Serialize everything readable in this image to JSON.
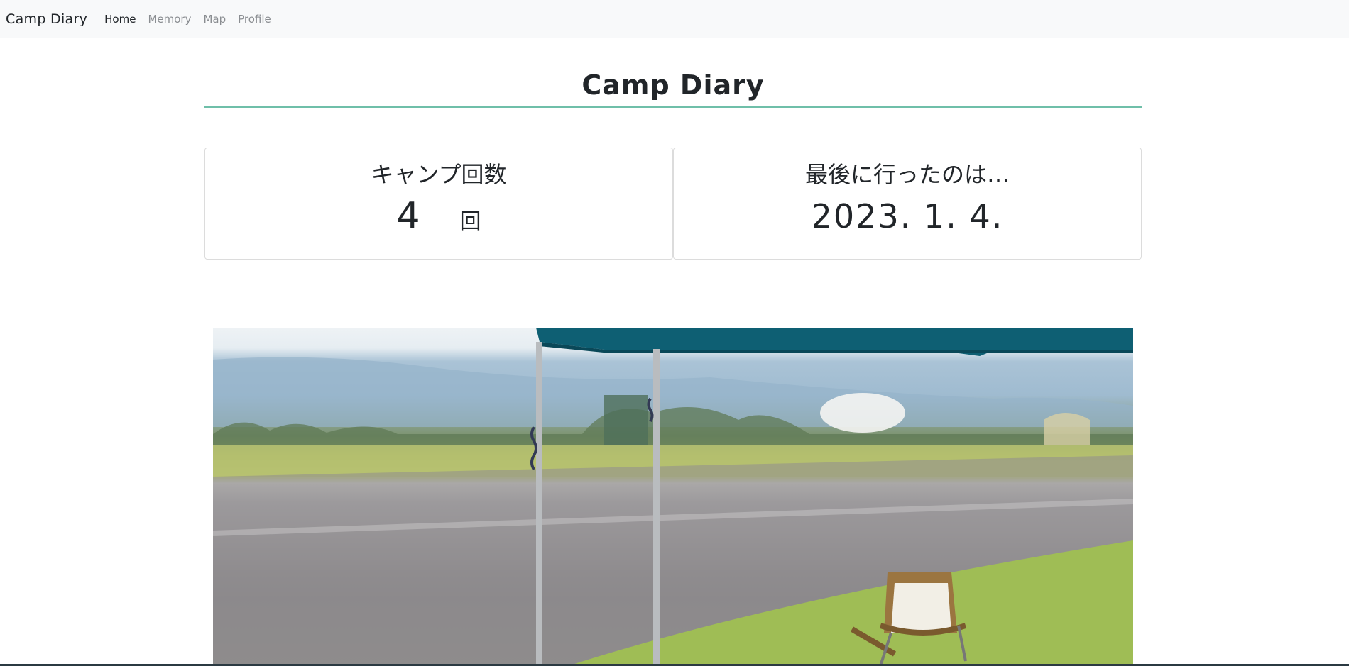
{
  "nav": {
    "brand": "Camp Diary",
    "links": [
      {
        "label": "Home",
        "active": true
      },
      {
        "label": "Memory",
        "active": false
      },
      {
        "label": "Map",
        "active": false
      },
      {
        "label": "Profile",
        "active": false
      }
    ]
  },
  "main": {
    "title": "Camp Diary",
    "stats": {
      "count_heading": "キャンプ回数",
      "count_value": "4",
      "count_unit": "回",
      "last_heading": "最後に行ったのは…",
      "last_date": "2023. 1. 4."
    }
  },
  "colors": {
    "title_rule": "#6fbfa9",
    "navbar_bg": "#f8f9fa",
    "canopy": "#0e5f73"
  }
}
